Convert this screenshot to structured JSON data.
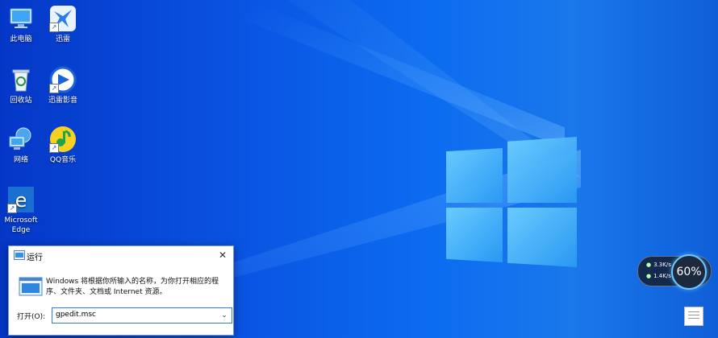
{
  "desktop_icons": [
    {
      "label": "此电脑",
      "icon": "computer-icon"
    },
    {
      "label": "迅雷",
      "icon": "thunder-icon"
    },
    {
      "label": "回收站",
      "icon": "recycle-bin-icon"
    },
    {
      "label": "迅雷影音",
      "icon": "thunder-player-icon"
    },
    {
      "label": "网络",
      "icon": "network-icon"
    },
    {
      "label": "QQ音乐",
      "icon": "qq-music-icon"
    },
    {
      "label": "Microsoft Edge",
      "icon": "edge-icon"
    }
  ],
  "run_dialog": {
    "title": "运行",
    "close": "✕",
    "description": "Windows 将根据你所输入的名称，为你打开相应的程序、文件夹、文档或 Internet 资源。",
    "open_label": "打开(O):",
    "input_value": "gpedit.msc",
    "dropdown": "⌄"
  },
  "network_widget": {
    "upload": "3.3K/s",
    "download": "1.4K/s",
    "percent": "60%"
  },
  "colors": {
    "wallpaper": "#0a55e3",
    "logo": "#4cb8ff"
  }
}
